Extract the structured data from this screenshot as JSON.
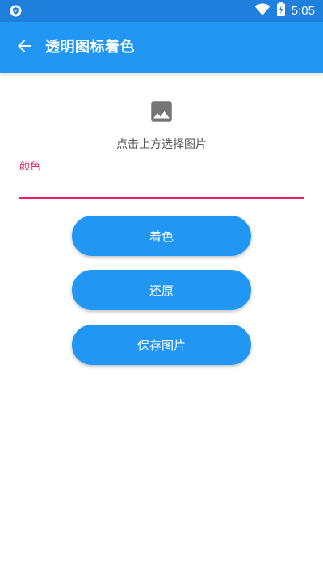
{
  "status_bar": {
    "time": "5:05",
    "icons": [
      "shield-icon",
      "wifi-icon",
      "battery-charging-icon"
    ]
  },
  "app_bar": {
    "title": "透明图标着色",
    "back_icon": "arrow-back-icon"
  },
  "image_picker": {
    "icon": "image-icon",
    "hint": "点击上方选择图片"
  },
  "color_field": {
    "label": "颜色",
    "value": "",
    "accent": "#e91e63"
  },
  "buttons": {
    "apply_color": "着色",
    "restore": "还原",
    "save_image": "保存图片"
  },
  "colors": {
    "primary": "#2196f3",
    "status_bar": "#1f7fdc",
    "accent": "#e91e63"
  }
}
